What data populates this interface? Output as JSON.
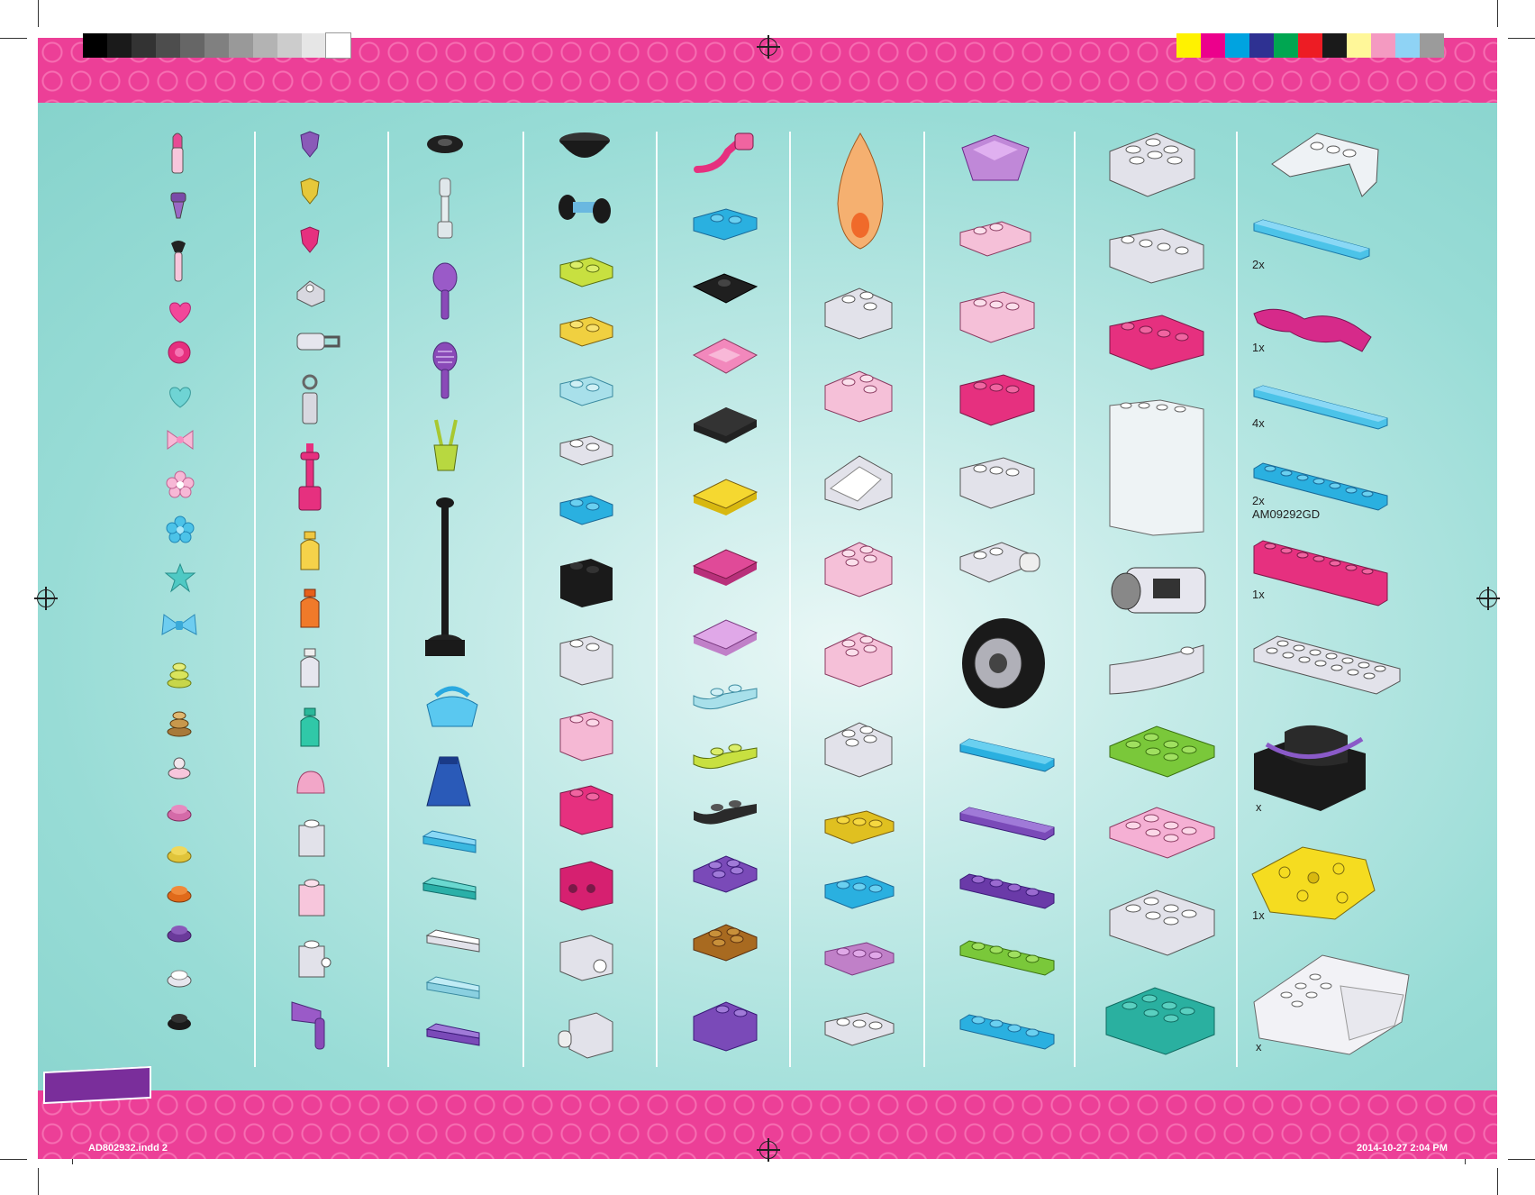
{
  "colors": {
    "band": "#ec3f97",
    "panel": "#98dcd6",
    "tab": "#7a2e9b"
  },
  "grayscale_swatches": [
    "#000000",
    "#1a1a1a",
    "#333333",
    "#4d4d4d",
    "#666666",
    "#808080",
    "#999999",
    "#b3b3b3",
    "#cccccc",
    "#e6e6e6",
    "#ffffff"
  ],
  "color_swatches": [
    "#fff200",
    "#ec008c",
    "#00a3e0",
    "#2e3192",
    "#00a651",
    "#ed1c24",
    "#1a1a1a",
    "#fff799",
    "#f49ac1",
    "#8fd3f5",
    "#9b9b9b"
  ],
  "quantities": [
    {
      "id": "q1",
      "text": "2x"
    },
    {
      "id": "q2",
      "text": "1x"
    },
    {
      "id": "q3",
      "text": "4x"
    },
    {
      "id": "q4",
      "text": "2x"
    },
    {
      "id": "q5",
      "text": "AM09292GD"
    },
    {
      "id": "q6",
      "text": "1x"
    },
    {
      "id": "q7",
      "text": "x"
    },
    {
      "id": "q8",
      "text": "1x"
    },
    {
      "id": "q9",
      "text": "x"
    }
  ],
  "footer": {
    "file": "AD802932.indd   2",
    "date": "2014-10-27   2:04 PM"
  }
}
